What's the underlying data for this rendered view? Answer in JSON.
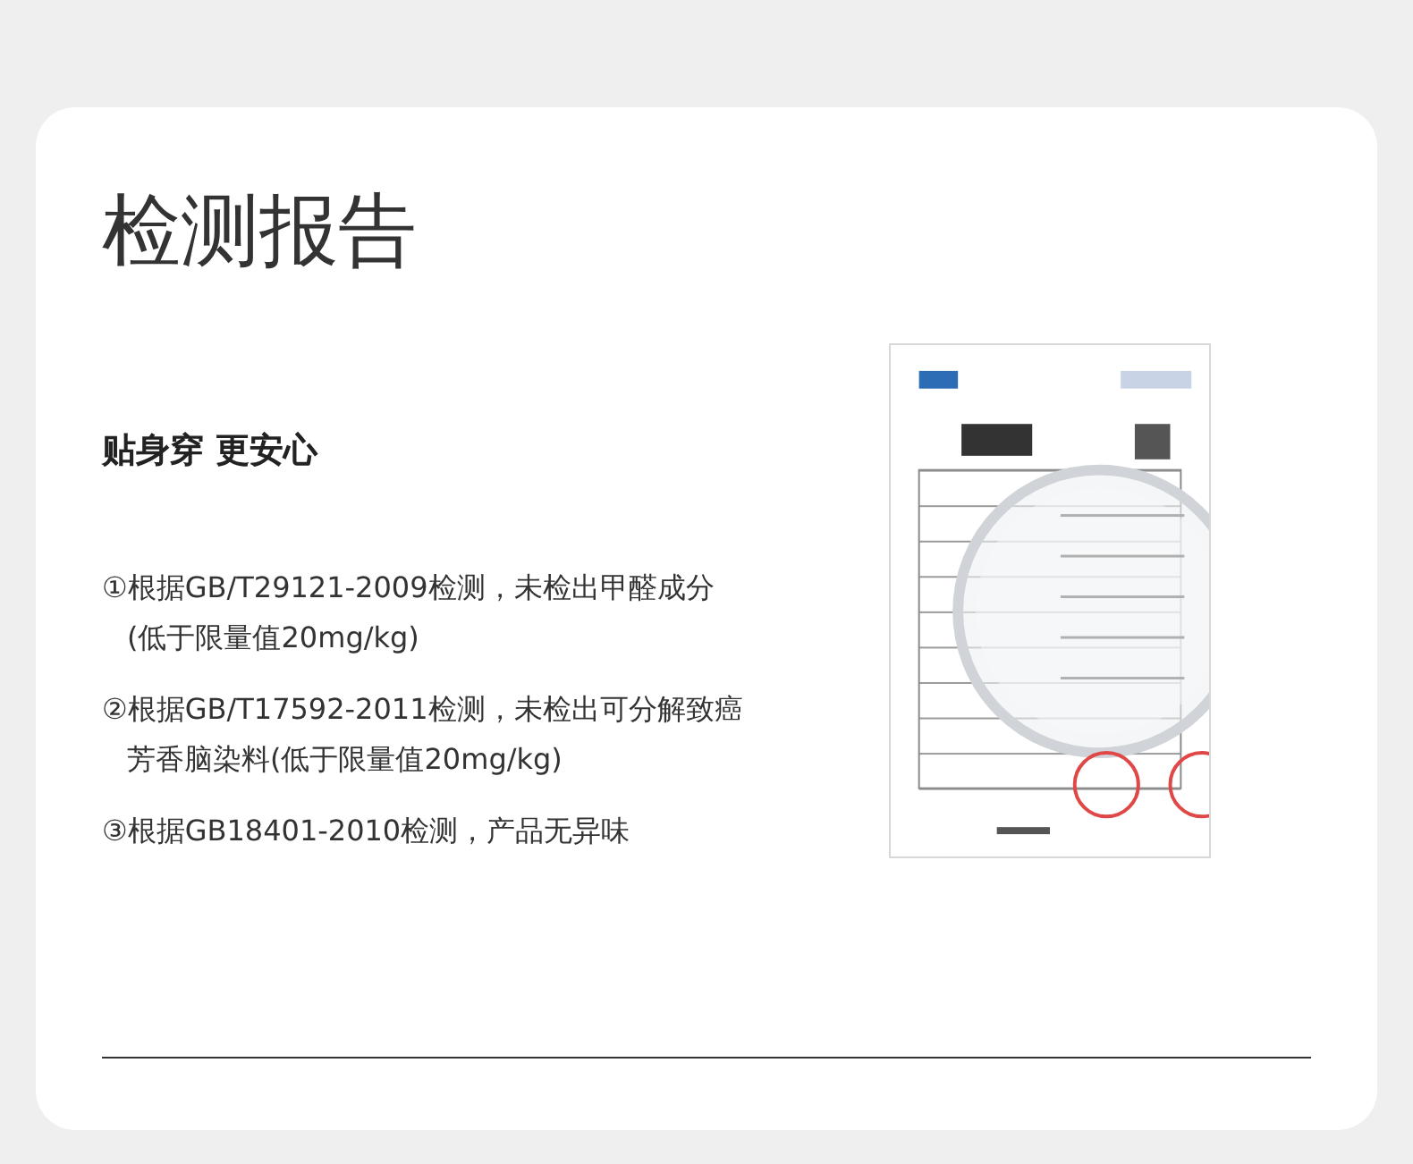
{
  "title": "检测报告",
  "subtitle": "贴身穿 更安心",
  "items": [
    {
      "lines": [
        "①根据GB/T29121-2009检测，未检出甲醛成分",
        "(低于限量值20mg/kg)"
      ]
    },
    {
      "lines": [
        "②根据GB/T17592-2011检测，未检出可分解致癌",
        "芳香脑染料(低于限量值20mg/kg)"
      ]
    },
    {
      "lines": [
        "③根据GB18401-2010检测，产品无异味"
      ]
    }
  ]
}
